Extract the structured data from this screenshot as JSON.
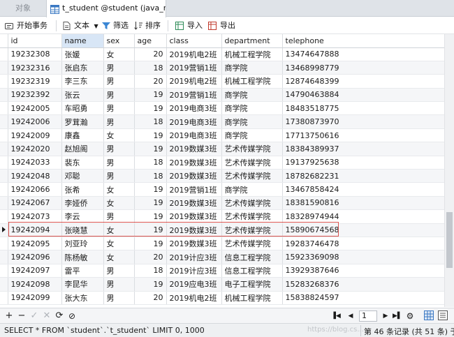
{
  "tabs": {
    "objects": "对象",
    "active": "t_student @student (java_m..."
  },
  "toolbar": {
    "begin_transaction": "开始事务",
    "text": "文本",
    "filter": "筛选",
    "sort": "排序",
    "import": "导入",
    "export": "导出"
  },
  "grid": {
    "columns": [
      "id",
      "name",
      "sex",
      "age",
      "class",
      "department",
      "telephone"
    ],
    "rows": [
      [
        "19232308",
        "张媛",
        "女",
        "20",
        "2019机电2班",
        "机械工程学院",
        "13474647888"
      ],
      [
        "19232316",
        "张启东",
        "男",
        "18",
        "2019营销1班",
        "商学院",
        "13468998779"
      ],
      [
        "19232319",
        "李三东",
        "男",
        "20",
        "2019机电2班",
        "机械工程学院",
        "12874648399"
      ],
      [
        "19232392",
        "张云",
        "男",
        "19",
        "2019营销1班",
        "商学院",
        "14790463884"
      ],
      [
        "19242005",
        "车昭勇",
        "男",
        "19",
        "2019电商3班",
        "商学院",
        "18483518775"
      ],
      [
        "19242006",
        "罗茸瀚",
        "男",
        "18",
        "2019电商3班",
        "商学院",
        "17380873970"
      ],
      [
        "19242009",
        "康鑫",
        "女",
        "19",
        "2019电商3班",
        "商学院",
        "17713750616"
      ],
      [
        "19242020",
        "赵旭阁",
        "男",
        "19",
        "2019数媒3班",
        "艺术传媒学院",
        "18384389937"
      ],
      [
        "19242033",
        "裴东",
        "男",
        "18",
        "2019数媒3班",
        "艺术传媒学院",
        "19137925638"
      ],
      [
        "19242048",
        "邓聪",
        "男",
        "18",
        "2019数媒3班",
        "艺术传媒学院",
        "18782682231"
      ],
      [
        "19242066",
        "张希",
        "女",
        "19",
        "2019营销1班",
        "商学院",
        "13467858424"
      ],
      [
        "19242067",
        "李娅侨",
        "女",
        "19",
        "2019数媒3班",
        "艺术传媒学院",
        "18381590816"
      ],
      [
        "19242073",
        "李云",
        "男",
        "19",
        "2019数媒3班",
        "艺术传媒学院",
        "18328974944"
      ],
      [
        "19242094",
        "张晓慧",
        "女",
        "19",
        "2019数媒3班",
        "艺术传媒学院",
        "15890674568"
      ],
      [
        "19242095",
        "刘亚玲",
        "女",
        "19",
        "2019数媒3班",
        "艺术传媒学院",
        "19283746478"
      ],
      [
        "19242096",
        "陈杨敏",
        "女",
        "20",
        "2019计应3班",
        "信息工程学院",
        "15923369098"
      ],
      [
        "19242097",
        "雷平",
        "男",
        "18",
        "2019计应3班",
        "信息工程学院",
        "13929387646"
      ],
      [
        "19242098",
        "李昆华",
        "男",
        "19",
        "2019应电3班",
        "电子工程学院",
        "15283268376"
      ],
      [
        "19242099",
        "张大东",
        "男",
        "20",
        "2019机电2班",
        "机械工程学院",
        "15838824597"
      ]
    ],
    "current_row": 13
  },
  "nav": {
    "page": "1"
  },
  "status": {
    "sql": "SELECT * FROM `student`.`t_student` LIMIT 0, 1000",
    "watermark": "https://blog.cs...",
    "record_info": "第 46 条记录 (共 51 条) 于"
  },
  "colors": {
    "accent": "#d8e6f6",
    "highlight_border": "#d9534f"
  }
}
